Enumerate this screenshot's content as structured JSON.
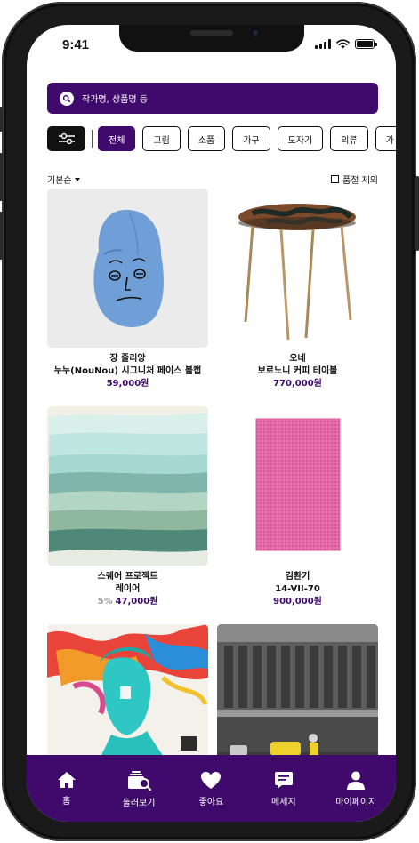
{
  "status_bar": {
    "time": "9:41"
  },
  "search": {
    "placeholder": "작가명, 상품명 등"
  },
  "filters": {
    "chips": [
      {
        "label": "전체",
        "active": true
      },
      {
        "label": "그림",
        "active": false
      },
      {
        "label": "소품",
        "active": false
      },
      {
        "label": "가구",
        "active": false
      },
      {
        "label": "도자기",
        "active": false
      },
      {
        "label": "의류",
        "active": false
      },
      {
        "label": "가",
        "active": false
      }
    ]
  },
  "sort": {
    "label": "기본순",
    "exclude_soldout_label": "품절 제외"
  },
  "products": [
    {
      "artist": "장 줄리앙",
      "title": "누누(NouNou) 시그니처 페이스 볼캡",
      "price": "59,000원",
      "discount": ""
    },
    {
      "artist": "오네",
      "title": "보로노니 커피 테이블",
      "price": "770,000원",
      "discount": ""
    },
    {
      "artist": "스퀘어 프로젝트",
      "title": "레이어",
      "price": "47,000원",
      "discount": "5%"
    },
    {
      "artist": "김환기",
      "title": "14-VII-70",
      "price": "900,000원",
      "discount": ""
    },
    {
      "artist": "",
      "title": "",
      "price": "",
      "discount": ""
    },
    {
      "artist": "",
      "title": "",
      "price": "",
      "discount": ""
    }
  ],
  "tabbar": {
    "items": [
      {
        "label": "홈",
        "icon": "home-icon"
      },
      {
        "label": "둘러보기",
        "icon": "browse-icon"
      },
      {
        "label": "좋아요",
        "icon": "heart-icon"
      },
      {
        "label": "메세지",
        "icon": "message-icon"
      },
      {
        "label": "마이페이지",
        "icon": "user-icon"
      }
    ]
  },
  "colors": {
    "brand": "#3f0a6b",
    "text": "#111111",
    "muted": "#9a9a9a"
  }
}
